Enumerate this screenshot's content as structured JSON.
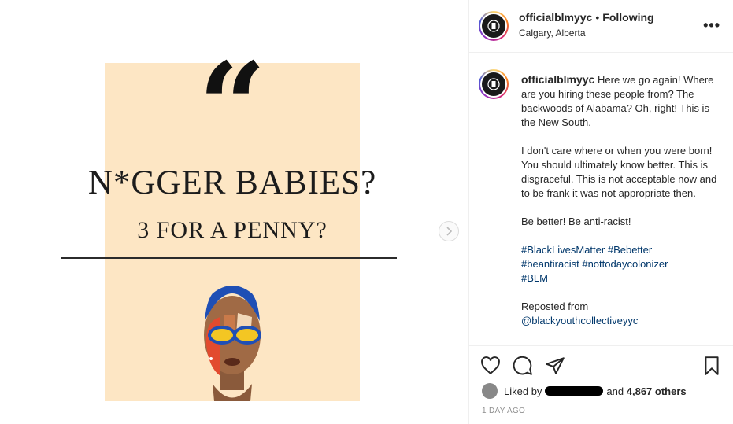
{
  "post": {
    "headline": "N*GGER BABIES?",
    "subhead": "3 FOR A PENNY?",
    "quote_glyph": "“"
  },
  "header": {
    "username": "officialblmyyc",
    "separator": "•",
    "follow_status": "Following",
    "location": "Calgary, Alberta",
    "more_label": "•••"
  },
  "caption": {
    "username": "officialblmyyc",
    "para1": "Here we go again! Where are you hiring these people from? The backwoods of Alabama? Oh, right! This is the New South.",
    "para2": "I don't care where or when you were born! You should ultimately know better. This is disgraceful. This is not acceptable now and to be frank it was not appropriate then.",
    "para3": "Be better! Be anti-racist!",
    "hashtags": [
      "#BlackLivesMatter",
      "#Bebetter",
      "#beantiracist",
      "#nottodaycolonizer",
      "#BLM"
    ],
    "repost_label": "Reposted from",
    "repost_handle": "@blackyouthcollectiveyyc"
  },
  "engagement": {
    "liked_by_label": "Liked by",
    "and_label": "and",
    "others_count": "4,867 others",
    "timestamp": "1 DAY AGO"
  },
  "icons": {
    "like": "heart-icon",
    "comment": "comment-icon",
    "share": "share-icon",
    "save": "bookmark-icon",
    "next": "chevron-right-icon"
  },
  "colors": {
    "poster_bg": "#fde6c4",
    "link": "#00376b",
    "muted": "#8e8e8e"
  }
}
